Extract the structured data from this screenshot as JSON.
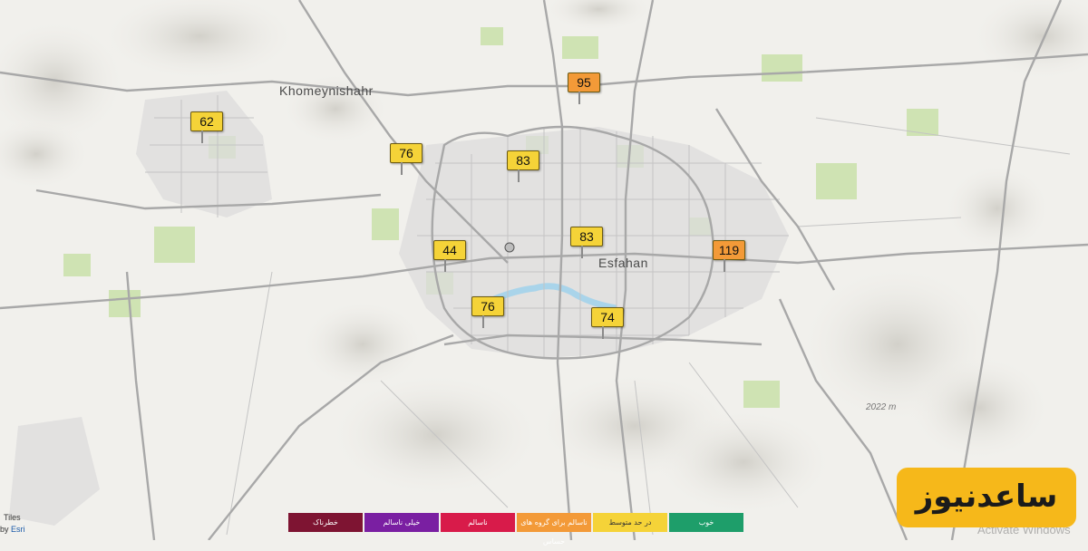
{
  "map": {
    "places": [
      {
        "id": "khomeynishahr",
        "label": "Khomeynishahr"
      },
      {
        "id": "esfahan",
        "label": "Esfahan"
      }
    ],
    "elevation": "2022 m"
  },
  "stations": [
    {
      "id": "st-62",
      "value": "62",
      "color": "#f5d338"
    },
    {
      "id": "st-95",
      "value": "95",
      "color": "#f39a38"
    },
    {
      "id": "st-76a",
      "value": "76",
      "color": "#f5d338"
    },
    {
      "id": "st-83a",
      "value": "83",
      "color": "#f5d338"
    },
    {
      "id": "st-83b",
      "value": "83",
      "color": "#f5d338"
    },
    {
      "id": "st-44",
      "value": "44",
      "color": "#f5d338"
    },
    {
      "id": "st-119",
      "value": "119",
      "color": "#f39a38"
    },
    {
      "id": "st-76b",
      "value": "76",
      "color": "#f5d338"
    },
    {
      "id": "st-74",
      "value": "74",
      "color": "#f5d338"
    }
  ],
  "legend": [
    {
      "label": "خطرناک",
      "color": "#7e1432"
    },
    {
      "label": "خیلی ناسالم",
      "color": "#7a1fa2"
    },
    {
      "label": "ناسالم",
      "color": "#d81b4a"
    },
    {
      "label": "ناسالم برای گروه های حساس",
      "color": "#f39a38"
    },
    {
      "label": "در حد متوسط",
      "color": "#f5d338"
    },
    {
      "label": "خوب",
      "color": "#1e9e6a"
    }
  ],
  "attribution": {
    "line1": "Tiles",
    "prefix": "by",
    "link": "Esri"
  },
  "watermark": "ساعدنیوز",
  "activate": "Activate Windows"
}
